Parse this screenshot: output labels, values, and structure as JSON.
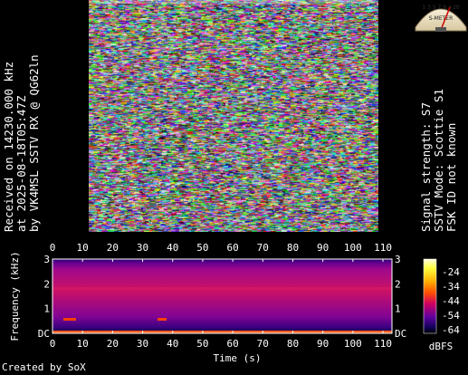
{
  "left_caption": {
    "line1": "Received on  14230.000 kHz",
    "line2": "at 2025-08-18T05:47Z",
    "line3": "by VK4MSL SSTV RX @ QG62ln"
  },
  "right_caption": {
    "line1": "Signal strength: S7",
    "line2": "SSTV Mode: Scottie S1",
    "line3": "FSK ID not known"
  },
  "meter": {
    "scale_text": "1 3 5 7 9 +20",
    "face_text": "S-METER"
  },
  "spectrogram": {
    "x_axis_label": "Time (s)",
    "y_axis_label": "Frequency (kHz)",
    "x_ticks": [
      "0",
      "10",
      "20",
      "30",
      "40",
      "50",
      "60",
      "70",
      "80",
      "90",
      "100",
      "110"
    ],
    "y_ticks": [
      "3",
      "2",
      "1",
      "DC"
    ],
    "colorbar_ticks": [
      "-24",
      "-34",
      "-44",
      "-54",
      "-64"
    ],
    "colorbar_unit": "dBFS",
    "colors": {
      "bg": "#3a0080",
      "band": "#c0106e",
      "hot": "#ff4000",
      "line": "#ff6020"
    }
  },
  "footer": "Created by SoX"
}
